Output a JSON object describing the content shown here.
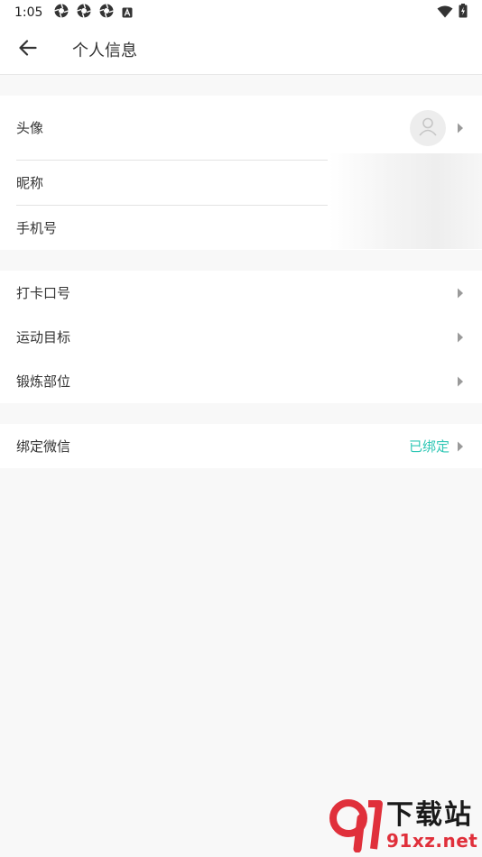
{
  "status_bar": {
    "time": "1:05",
    "notification_icons": [
      "aperture-icon",
      "aperture-icon",
      "aperture-icon",
      "a-badge-icon"
    ],
    "right_icons": [
      "wifi-icon",
      "battery-charging-icon"
    ]
  },
  "header": {
    "title": "个人信息",
    "back_icon": "arrow-left-icon"
  },
  "groups": [
    {
      "rows": [
        {
          "label": "头像",
          "right": "avatar",
          "chevron": true
        },
        {
          "label": "昵称",
          "chevron": false
        },
        {
          "label": "手机号",
          "chevron": false
        }
      ]
    },
    {
      "rows": [
        {
          "label": "打卡口号",
          "chevron": true
        },
        {
          "label": "运动目标",
          "chevron": true
        },
        {
          "label": "锻炼部位",
          "chevron": true
        }
      ]
    },
    {
      "rows": [
        {
          "label": "绑定微信",
          "value": "已绑定",
          "chevron": true
        }
      ]
    }
  ],
  "watermark": {
    "logo_text": "下载站",
    "url_text": "91xz.net"
  },
  "colors": {
    "accent": "#2fc7b5",
    "background": "#f8f8f8",
    "card": "#ffffff",
    "watermark_red": "#e0303b"
  }
}
